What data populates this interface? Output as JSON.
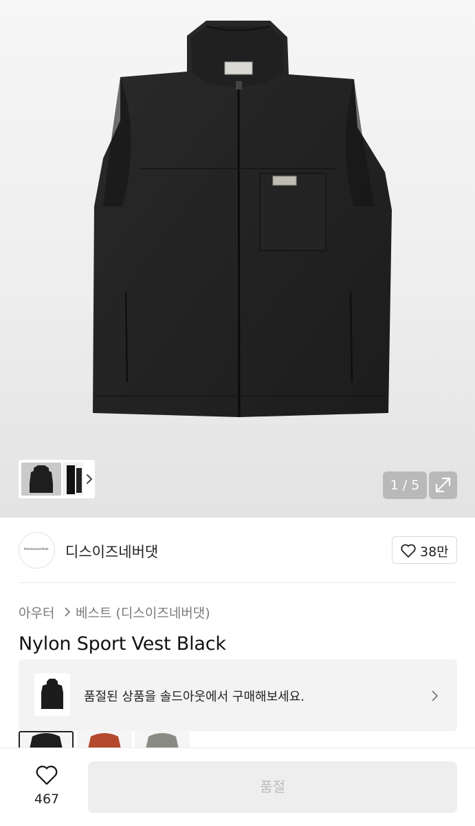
{
  "gallery": {
    "counter": "1 / 5",
    "product_label_text": "thisisneverthat"
  },
  "brand": {
    "logo_text": "thisisneverthat",
    "name": "디스이즈네버댓",
    "like_count": "38만"
  },
  "breadcrumb": {
    "category": "아우터",
    "subcategory": "베스트 (디스이즈네버댓)"
  },
  "product": {
    "title": "Nylon Sport Vest Black"
  },
  "soldout_banner": {
    "text": "품절된 상품을 솔드아웃에서 구매해보세요."
  },
  "color_options": [
    {
      "name": "black",
      "color": "#1e1e1e"
    },
    {
      "name": "rust",
      "color": "#b5492e"
    },
    {
      "name": "gray",
      "color": "#8a8c84"
    }
  ],
  "bottom_bar": {
    "wish_count": "467",
    "buy_label": "품절"
  },
  "icons": [
    "heart-icon",
    "chevron-right-icon",
    "expand-icon"
  ]
}
